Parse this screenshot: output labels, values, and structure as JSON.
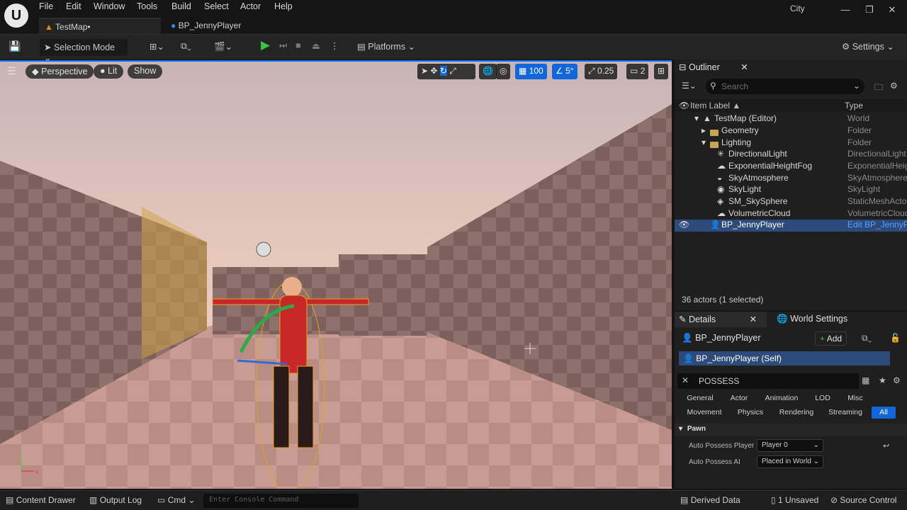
{
  "menu": {
    "items": [
      "File",
      "Edit",
      "Window",
      "Tools",
      "Build",
      "Select",
      "Actor",
      "Help"
    ],
    "project": "City"
  },
  "tabs": [
    {
      "label": "TestMap•"
    },
    {
      "label": "BP_JennyPlayer"
    }
  ],
  "toolbar": {
    "selection_mode": "Selection Mode",
    "platforms": "Platforms",
    "settings": "Settings"
  },
  "viewport": {
    "perspective": "Perspective",
    "lit": "Lit",
    "show": "Show",
    "grid_snap": "100",
    "angle_snap": "5°",
    "scale_snap": "0.25",
    "camera_speed": "2"
  },
  "outliner": {
    "title": "Outliner",
    "search_placeholder": "Search",
    "col_label": "Item Label ▲",
    "col_type": "Type",
    "rows": [
      {
        "label": "TestMap (Editor)",
        "type": "World"
      },
      {
        "label": "Geometry",
        "type": "Folder"
      },
      {
        "label": "Lighting",
        "type": "Folder"
      },
      {
        "label": "DirectionalLight",
        "type": "DirectionalLight"
      },
      {
        "label": "ExponentialHeightFog",
        "type": "ExponentialHeightFog"
      },
      {
        "label": "SkyAtmosphere",
        "type": "SkyAtmosphere"
      },
      {
        "label": "SkyLight",
        "type": "SkyLight"
      },
      {
        "label": "SM_SkySphere",
        "type": "StaticMeshActor"
      },
      {
        "label": "VolumetricCloud",
        "type": "VolumetricCloud"
      },
      {
        "label": "BP_JennyPlayer",
        "type": "Edit BP_JennyPlayer"
      }
    ],
    "status": "36 actors (1 selected)"
  },
  "details": {
    "title": "Details",
    "world_settings": "World Settings",
    "actor_name": "BP_JennyPlayer",
    "add": "Add",
    "self_item": "BP_JennyPlayer (Self)",
    "filter": "POSSESS",
    "chips_row1": [
      "General",
      "Actor",
      "Animation",
      "LOD",
      "Misc"
    ],
    "chips_row2": [
      "Movement",
      "Physics",
      "Rendering",
      "Streaming",
      "All"
    ],
    "category": "Pawn",
    "props": [
      {
        "label": "Auto Possess Player",
        "value": "Player 0"
      },
      {
        "label": "Auto Possess AI",
        "value": "Placed in World"
      }
    ]
  },
  "statusbar": {
    "content_drawer": "Content Drawer",
    "output_log": "Output Log",
    "cmd": "Cmd",
    "console_placeholder": "Enter Console Command",
    "derived_data": "Derived Data",
    "unsaved": "1 Unsaved",
    "source_control": "Source Control"
  },
  "colors": {
    "accent": "#1167d9",
    "selection": "#2c4b7a"
  }
}
